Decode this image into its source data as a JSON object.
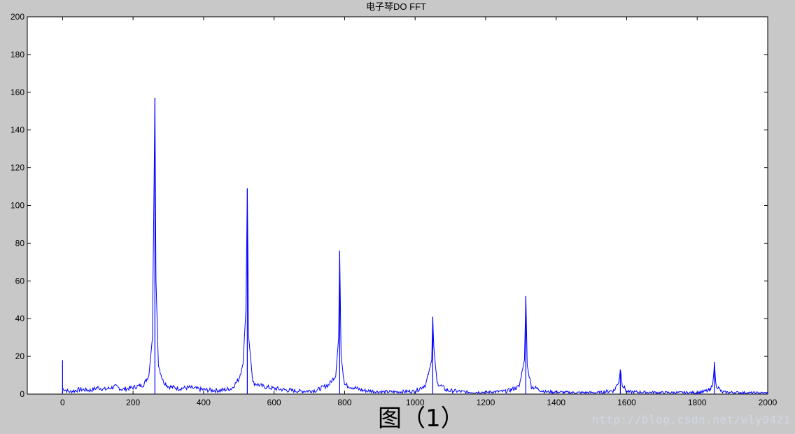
{
  "chart_data": {
    "type": "line",
    "title": "电子琴DO FFT",
    "xlabel": "",
    "ylabel": "",
    "xlim": [
      -100,
      2000
    ],
    "ylim": [
      0,
      200
    ],
    "x_ticks": [
      0,
      200,
      400,
      600,
      800,
      1000,
      1200,
      1400,
      1600,
      1800,
      2000
    ],
    "y_ticks": [
      0,
      20,
      40,
      60,
      80,
      100,
      120,
      140,
      160,
      180,
      200
    ],
    "grid": false,
    "series": [
      {
        "color": "#0000ff",
        "baseline": [
          [
            0,
            3
          ],
          [
            20,
            1.2
          ],
          [
            50,
            2.5
          ],
          [
            80,
            2
          ],
          [
            100,
            3.5
          ],
          [
            120,
            2.5
          ],
          [
            150,
            4
          ],
          [
            170,
            2.5
          ],
          [
            200,
            3.5
          ],
          [
            230,
            5
          ],
          [
            245,
            10
          ],
          [
            255,
            30
          ],
          [
            262,
            157
          ],
          [
            265,
            60
          ],
          [
            272,
            15
          ],
          [
            285,
            7
          ],
          [
            300,
            4
          ],
          [
            330,
            3
          ],
          [
            360,
            3.5
          ],
          [
            390,
            2.5
          ],
          [
            420,
            2
          ],
          [
            450,
            2
          ],
          [
            480,
            3
          ],
          [
            500,
            8
          ],
          [
            512,
            16
          ],
          [
            520,
            45
          ],
          [
            524,
            109
          ],
          [
            528,
            30
          ],
          [
            540,
            6
          ],
          [
            570,
            4
          ],
          [
            600,
            3
          ],
          [
            640,
            2
          ],
          [
            680,
            1.5
          ],
          [
            720,
            2
          ],
          [
            755,
            5
          ],
          [
            775,
            10
          ],
          [
            783,
            30
          ],
          [
            786,
            76
          ],
          [
            790,
            20
          ],
          [
            800,
            5
          ],
          [
            850,
            2
          ],
          [
            900,
            1.2
          ],
          [
            950,
            1.2
          ],
          [
            1000,
            1.5
          ],
          [
            1030,
            5
          ],
          [
            1047,
            18
          ],
          [
            1050,
            41
          ],
          [
            1053,
            25
          ],
          [
            1062,
            6
          ],
          [
            1090,
            2
          ],
          [
            1150,
            1
          ],
          [
            1200,
            1
          ],
          [
            1260,
            1.5
          ],
          [
            1295,
            4
          ],
          [
            1310,
            18
          ],
          [
            1314,
            52
          ],
          [
            1318,
            15
          ],
          [
            1330,
            4
          ],
          [
            1370,
            1.2
          ],
          [
            1450,
            0.8
          ],
          [
            1520,
            0.8
          ],
          [
            1565,
            2
          ],
          [
            1578,
            7
          ],
          [
            1582,
            13
          ],
          [
            1588,
            5
          ],
          [
            1600,
            1.2
          ],
          [
            1700,
            0.8
          ],
          [
            1800,
            0.8
          ],
          [
            1838,
            2
          ],
          [
            1846,
            8
          ],
          [
            1849,
            17
          ],
          [
            1853,
            5
          ],
          [
            1870,
            1
          ],
          [
            1950,
            0.7
          ],
          [
            2000,
            0.6
          ]
        ],
        "spikes": [
          [
            0,
            18
          ],
          [
            262,
            157
          ],
          [
            524,
            109
          ],
          [
            786,
            76
          ],
          [
            1050,
            41
          ],
          [
            1314,
            52
          ],
          [
            1582,
            13
          ],
          [
            1849,
            17
          ]
        ]
      }
    ]
  },
  "caption": "图（1）",
  "watermark": "http://blog.csdn.net/wly0421"
}
